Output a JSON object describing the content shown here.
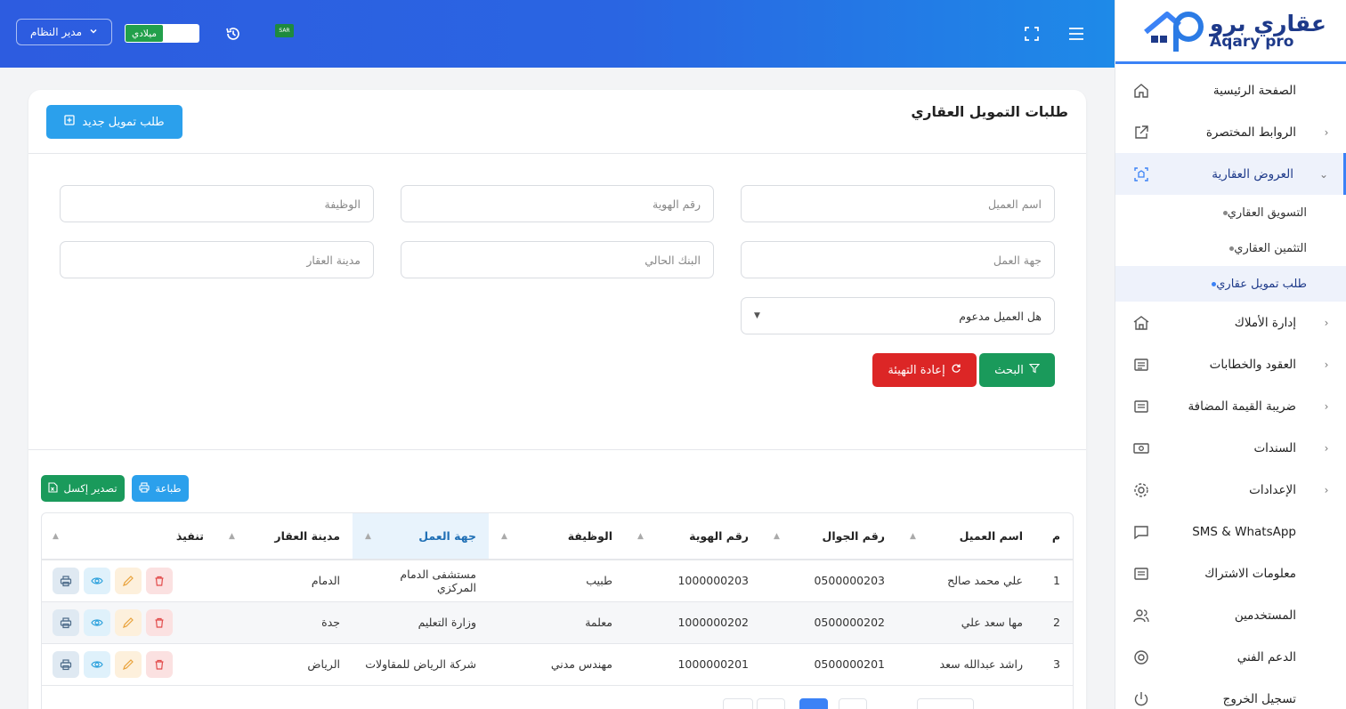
{
  "header": {
    "admin_label": "مدير النظام",
    "calendar_label": "ميلادي",
    "flag_text": "SAR"
  },
  "sidebar": {
    "logo_ar": "عقاري برو",
    "logo_en": "Aqary pro",
    "items": [
      {
        "label": "الصفحة الرئيسية",
        "icon": "home-icon"
      },
      {
        "label": "الروابط المختصرة",
        "icon": "external-link-icon"
      },
      {
        "label": "العروض العقارية",
        "icon": "building-scan-icon"
      },
      {
        "label": "إدارة الأملاك",
        "icon": "house-icon"
      },
      {
        "label": "العقود والخطابات",
        "icon": "document-icon"
      },
      {
        "label": "ضريبة القيمة المضافة",
        "icon": "receipt-icon"
      },
      {
        "label": "السندات",
        "icon": "banknote-icon"
      },
      {
        "label": "الإعدادات",
        "icon": "gear-icon"
      },
      {
        "label": "SMS & WhatsApp",
        "icon": "message-icon"
      },
      {
        "label": "معلومات الاشتراك",
        "icon": "list-icon"
      },
      {
        "label": "المستخدمين",
        "icon": "users-icon"
      },
      {
        "label": "الدعم الفني",
        "icon": "support-icon"
      },
      {
        "label": "تسجيل الخروج",
        "icon": "power-icon"
      }
    ],
    "sub_items": [
      {
        "label": "التسويق العقاري"
      },
      {
        "label": "التثمين العقاري"
      },
      {
        "label": "طلب تمويل عقاري"
      }
    ]
  },
  "page": {
    "title": "طلبات التمويل العقاري",
    "new_button": "طلب تمويل جديد"
  },
  "filters": {
    "client_name": "اسم العميل",
    "id_number": "رقم الهوية",
    "job": "الوظيفة",
    "employer": "جهة العمل",
    "current_bank": "البنك الحالي",
    "property_city": "مدينة العقار",
    "supported_select": "هل العميل مدعوم",
    "search_button": "البحث",
    "reset_button": "إعادة التهيئة"
  },
  "toolbar": {
    "excel_button": "تصدير إكسل",
    "print_button": "طباعة"
  },
  "table": {
    "headers": [
      "م",
      "اسم العميل",
      "رقم الجوال",
      "رقم الهوية",
      "الوظيفة",
      "جهة العمل",
      "مدينة العقار",
      "تنفيذ"
    ],
    "rows": [
      {
        "no": "1",
        "name": "علي محمد صالح",
        "mobile": "0500000203",
        "id": "1000000203",
        "job": "طبيب",
        "employer": "مستشفى الدمام المركزي",
        "city": "الدمام"
      },
      {
        "no": "2",
        "name": "مها سعد علي",
        "mobile": "0500000202",
        "id": "1000000202",
        "job": "معلمة",
        "employer": "وزارة التعليم",
        "city": "جدة"
      },
      {
        "no": "3",
        "name": "راشد عبدالله سعد",
        "mobile": "0500000201",
        "id": "1000000201",
        "job": "مهندس مدني",
        "employer": "شركة الرياض للمقاولات",
        "city": "الرياض"
      }
    ]
  },
  "colors": {
    "primary": "#2ba0ec",
    "success": "#1a9a5b",
    "danger": "#dc2626",
    "header_start": "#2d5ce0",
    "header_end": "#1e8ae8"
  }
}
